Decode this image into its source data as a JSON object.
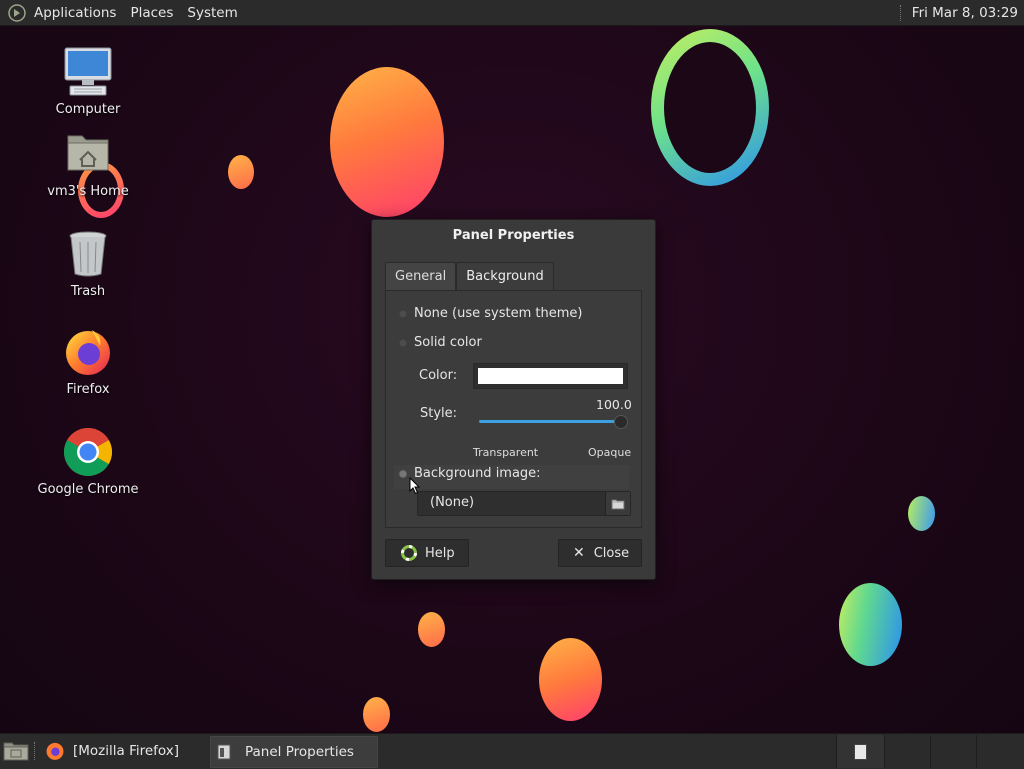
{
  "top_panel": {
    "menus": [
      "Applications",
      "Places",
      "System"
    ],
    "clock": "Fri Mar  8, 03:29"
  },
  "desktop_icons": [
    {
      "label": "Computer",
      "icon": "computer-icon"
    },
    {
      "label": "vm3's Home",
      "icon": "home-folder-icon"
    },
    {
      "label": "Trash",
      "icon": "trash-icon"
    },
    {
      "label": "Firefox",
      "icon": "firefox-icon"
    },
    {
      "label": "Google Chrome",
      "icon": "chrome-icon"
    }
  ],
  "dialog": {
    "title": "Panel Properties",
    "tabs": [
      "General",
      "Background"
    ],
    "active_tab": "Background",
    "options": {
      "none": "None (use system theme)",
      "solid": "Solid color",
      "image": "Background image:"
    },
    "selected_option": "image",
    "color_label": "Color:",
    "color_value": "#ffffff",
    "style_label": "Style:",
    "style_value": "100.0",
    "style_min_label": "Transparent",
    "style_max_label": "Opaque",
    "image_value": "(None)",
    "help_label": "Help",
    "close_label": "Close"
  },
  "bottom_panel": {
    "tasks": [
      "[Mozilla Firefox]",
      "Panel Properties"
    ]
  },
  "colors": {
    "accent": "#3da0e0",
    "panel": "#2b2b2b",
    "dialog": "#3a3a3a"
  }
}
